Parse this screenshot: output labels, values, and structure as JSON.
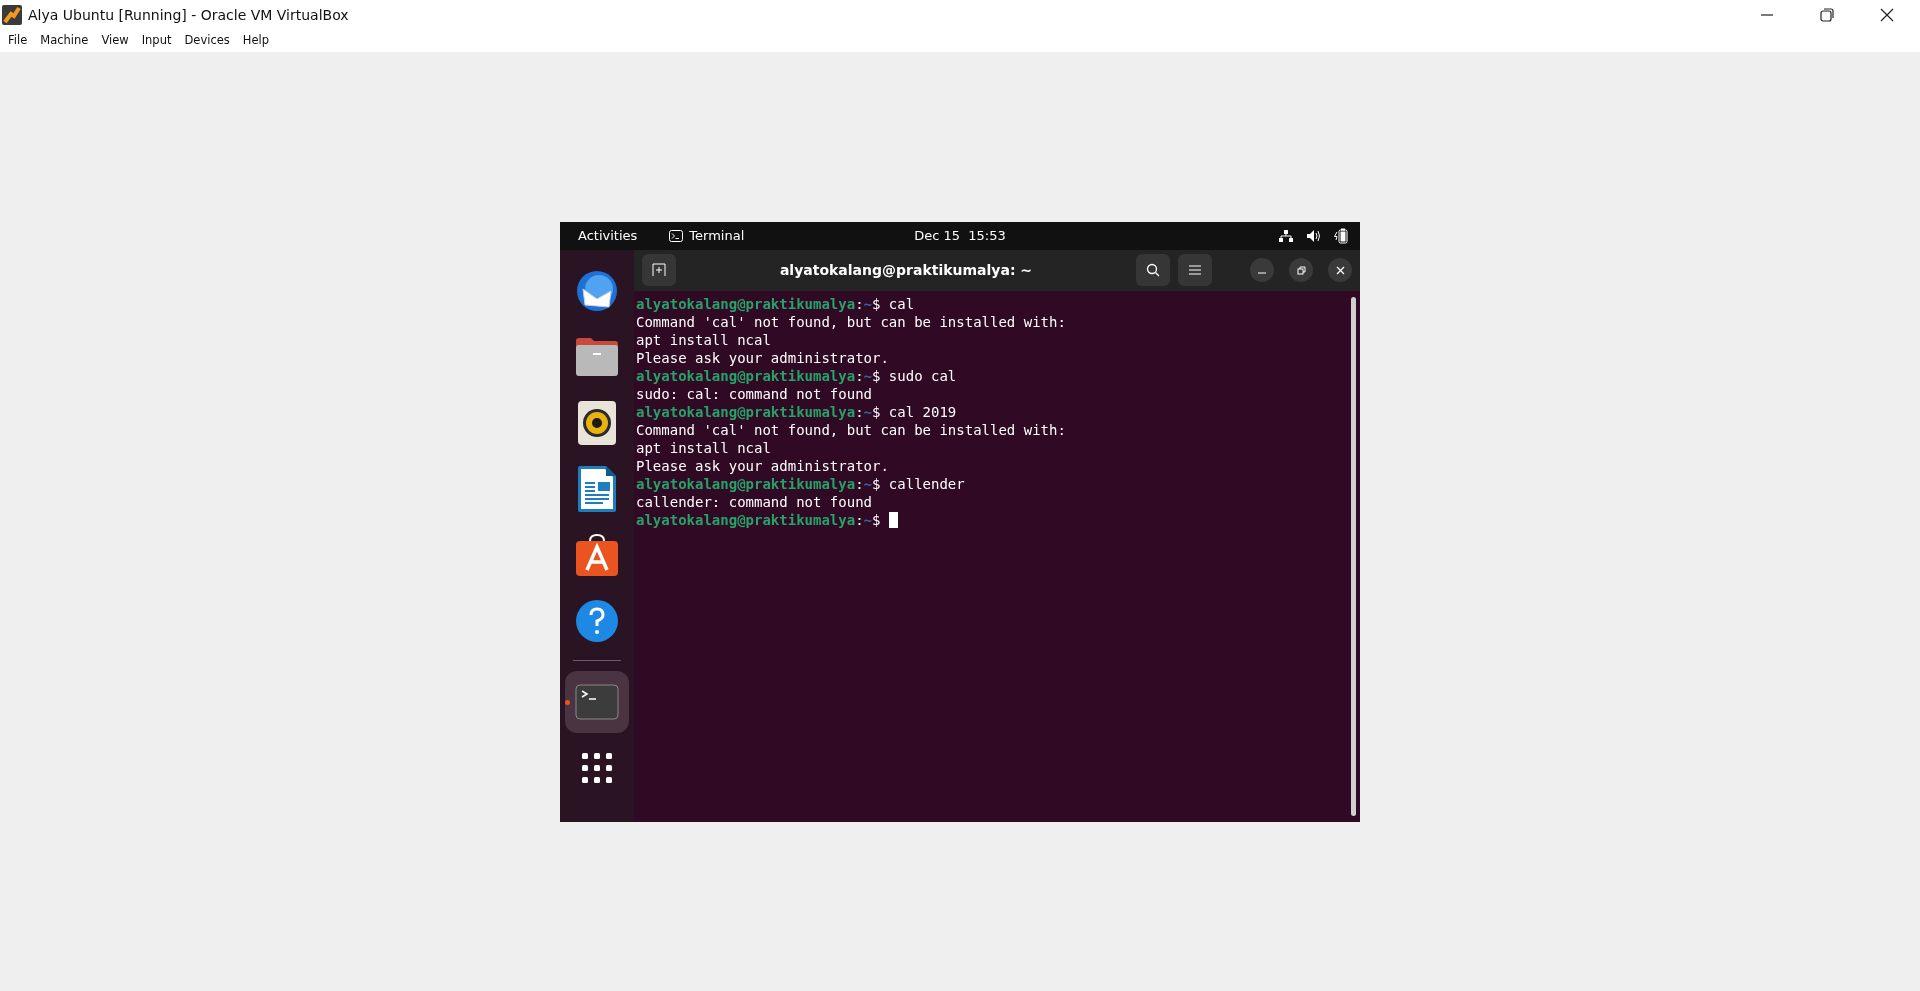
{
  "window": {
    "title": "Alya Ubuntu [Running] - Oracle VM VirtualBox"
  },
  "menu": [
    "File",
    "Machine",
    "View",
    "Input",
    "Devices",
    "Help"
  ],
  "top_bar": {
    "activities": "Activities",
    "app": "Terminal",
    "clock": "Dec 15  15:53"
  },
  "dock": [
    {
      "kind": "mail",
      "selected": false
    },
    {
      "kind": "files",
      "selected": false
    },
    {
      "kind": "music",
      "selected": false
    },
    {
      "kind": "writer",
      "selected": false
    },
    {
      "kind": "store",
      "selected": false
    },
    {
      "kind": "help",
      "selected": false
    },
    {
      "kind": "terminal",
      "selected": true
    }
  ],
  "terminal": {
    "title": "alyatokalang@praktikumalya: ~",
    "lines": [
      {
        "kind": "prompt",
        "user": "alyatokalang@praktikumalya",
        "sep": ":",
        "path": "~",
        "sign": "$",
        "command": "cal"
      },
      {
        "kind": "output",
        "text": "Command 'cal' not found, but can be installed with:"
      },
      {
        "kind": "output",
        "text": "apt install ncal"
      },
      {
        "kind": "output",
        "text": "Please ask your administrator."
      },
      {
        "kind": "prompt",
        "user": "alyatokalang@praktikumalya",
        "sep": ":",
        "path": "~",
        "sign": "$",
        "command": "sudo cal"
      },
      {
        "kind": "output",
        "text": "sudo: cal: command not found"
      },
      {
        "kind": "prompt",
        "user": "alyatokalang@praktikumalya",
        "sep": ":",
        "path": "~",
        "sign": "$",
        "command": "cal 2019"
      },
      {
        "kind": "output",
        "text": "Command 'cal' not found, but can be installed with:"
      },
      {
        "kind": "output",
        "text": "apt install ncal"
      },
      {
        "kind": "output",
        "text": "Please ask your administrator."
      },
      {
        "kind": "prompt",
        "user": "alyatokalang@praktikumalya",
        "sep": ":",
        "path": "~",
        "sign": "$",
        "command": "callender"
      },
      {
        "kind": "output",
        "text": "callender: command not found"
      },
      {
        "kind": "prompt",
        "user": "alyatokalang@praktikumalya",
        "sep": ":",
        "path": "~",
        "sign": "$",
        "cursor": true
      }
    ]
  }
}
